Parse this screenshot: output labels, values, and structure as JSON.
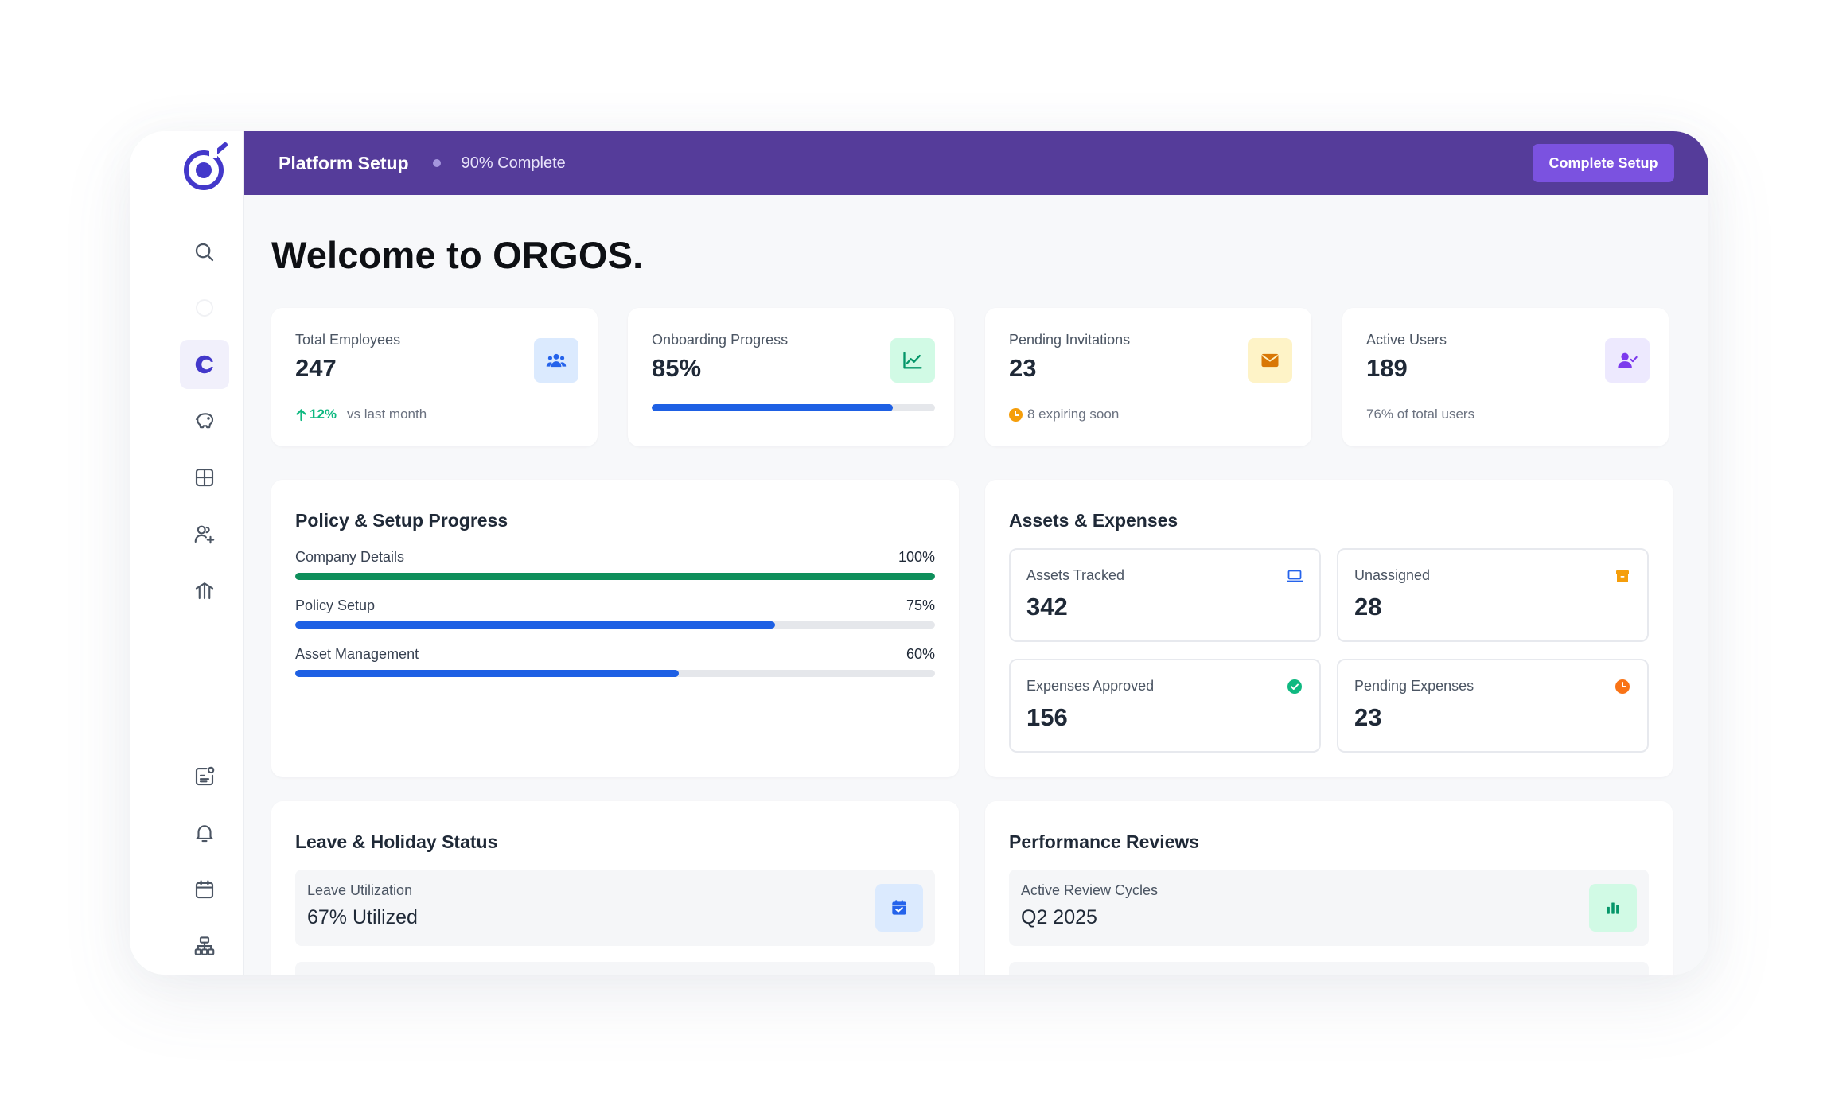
{
  "topbar": {
    "title": "Platform Setup",
    "progress": "90% Complete",
    "button": "Complete Setup",
    "color": "#553c9a"
  },
  "sidebar": {
    "items": [
      {
        "icon": "search-icon"
      },
      {
        "icon": "blank-circle-icon"
      },
      {
        "icon": "orgos-c-icon",
        "active": true
      },
      {
        "icon": "piggy-bank-icon"
      },
      {
        "icon": "grid-icon"
      },
      {
        "icon": "user-plus-icon"
      },
      {
        "icon": "org-chart-icon"
      },
      {
        "icon": "document-badge-icon"
      },
      {
        "icon": "bell-icon"
      },
      {
        "icon": "calendar-icon"
      },
      {
        "icon": "hierarchy-icon"
      }
    ]
  },
  "welcome": "Welcome to ORGOS.",
  "stats": {
    "employees": {
      "label": "Total Employees",
      "value": "247",
      "trend": "12%",
      "trend_text": "vs last month",
      "icon": "users-icon"
    },
    "onboarding": {
      "label": "Onboarding Progress",
      "value": "85%",
      "progress": 85,
      "icon": "trend-chart-icon"
    },
    "invitations": {
      "label": "Pending Invitations",
      "value": "23",
      "sub": "8 expiring soon",
      "icon": "envelope-icon"
    },
    "active": {
      "label": "Active Users",
      "value": "189",
      "sub": "76% of total users",
      "icon": "user-check-icon"
    }
  },
  "policy": {
    "title": "Policy & Setup Progress",
    "rows": [
      {
        "label": "Company Details",
        "pct": "100%",
        "value": 100,
        "color": "#0e8f5b"
      },
      {
        "label": "Policy Setup",
        "pct": "75%",
        "value": 75,
        "color": "#1e60e4"
      },
      {
        "label": "Asset Management",
        "pct": "60%",
        "value": 60,
        "color": "#1e60e4"
      }
    ]
  },
  "assets": {
    "title": "Assets & Expenses",
    "tracked": {
      "label": "Assets Tracked",
      "value": "342",
      "icon": "laptop-icon"
    },
    "unassigned": {
      "label": "Unassigned",
      "value": "28",
      "icon": "box-icon"
    },
    "approved": {
      "label": "Expenses Approved",
      "value": "156",
      "icon": "check-circle-icon"
    },
    "pending": {
      "label": "Pending Expenses",
      "value": "23",
      "icon": "clock-icon"
    }
  },
  "leave": {
    "title": "Leave & Holiday Status",
    "row_label": "Leave Utilization",
    "row_value": "67% Utilized",
    "icon": "calendar-check-icon"
  },
  "performance": {
    "title": "Performance Reviews",
    "row_label": "Active Review Cycles",
    "row_value": "Q2 2025",
    "icon": "bar-chart-icon"
  }
}
